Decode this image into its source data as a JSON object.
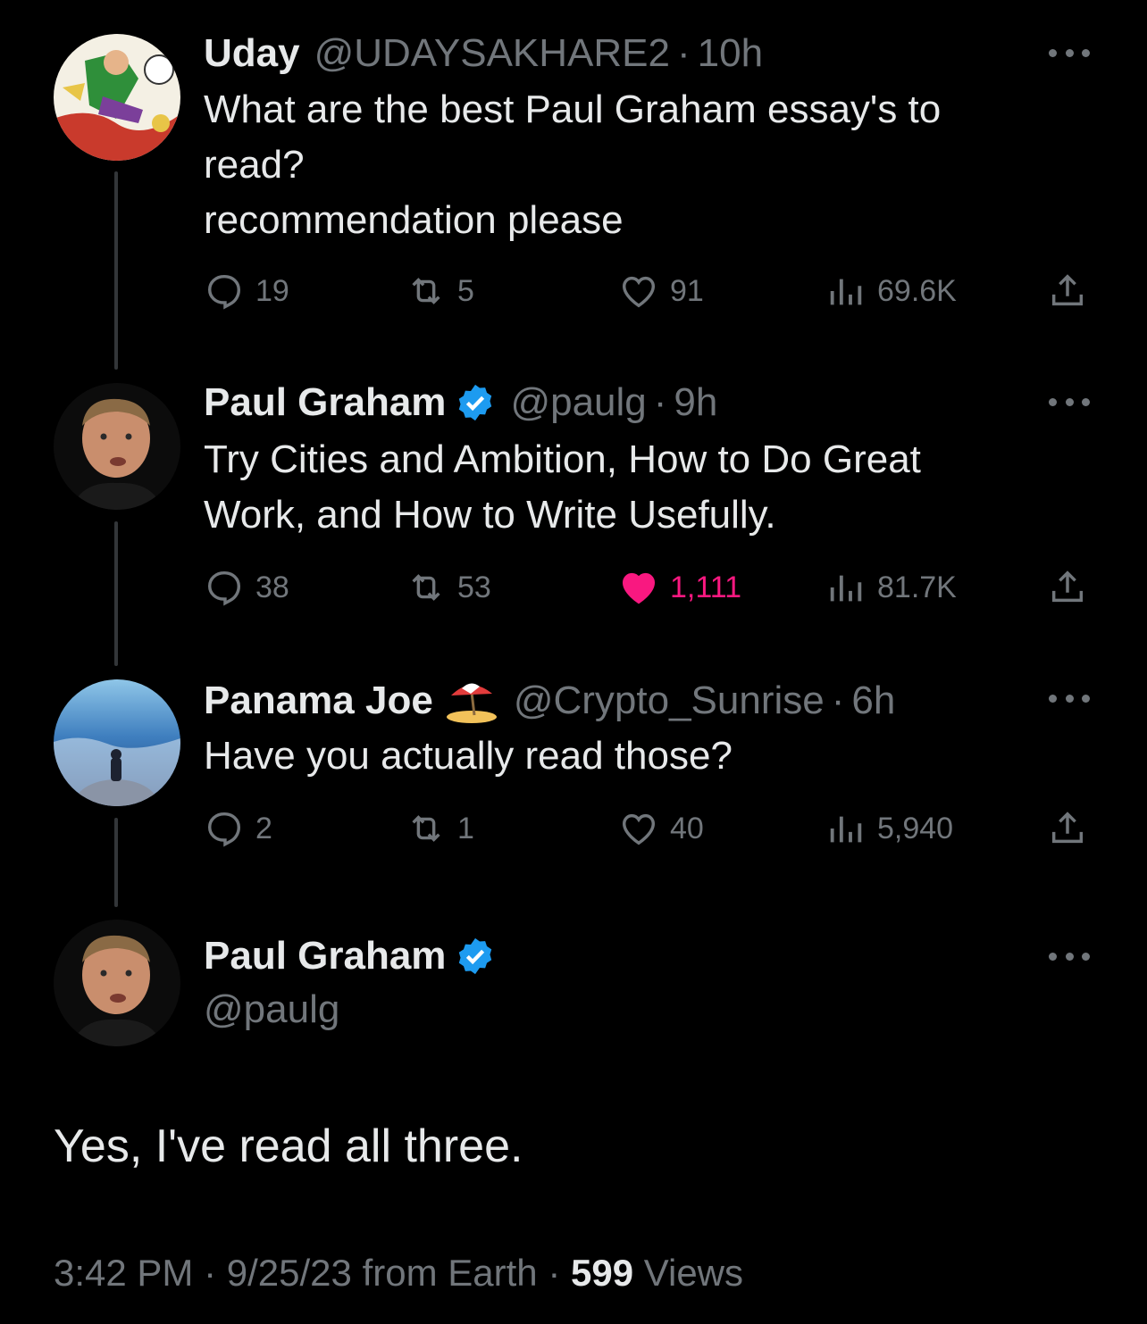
{
  "tweets": [
    {
      "name": "Uday",
      "handle": "@UDAYSAKHARE2",
      "separator": "·",
      "time": "10h",
      "verified": false,
      "emoji": "",
      "text_lines": [
        "What are the best Paul Graham essay's to",
        "read?",
        "recommendation please"
      ],
      "replies": "19",
      "retweets": "5",
      "likes": "91",
      "views": "69.6K",
      "liked": false
    },
    {
      "name": "Paul Graham",
      "handle": "@paulg",
      "separator": "·",
      "time": "9h",
      "verified": true,
      "emoji": "",
      "text_lines": [
        "Try Cities and Ambition, How to Do Great",
        "Work, and How to Write Usefully."
      ],
      "replies": "38",
      "retweets": "53",
      "likes": "1,111",
      "views": "81.7K",
      "liked": true
    },
    {
      "name": "Panama Joe",
      "handle": "@Crypto_Sunrise",
      "separator": "·",
      "time": "6h",
      "verified": false,
      "emoji": "beach-umbrella-island-emoji",
      "text_lines": [
        "Have you actually read those?"
      ],
      "replies": "2",
      "retweets": "1",
      "likes": "40",
      "views": "5,940",
      "liked": false
    }
  ],
  "main_tweet": {
    "name": "Paul Graham",
    "handle": "@paulg",
    "verified": true,
    "text": "Yes, I've read all three.",
    "time": "3:42 PM",
    "date": "9/25/23",
    "source": "from Earth",
    "separator": "·",
    "views_count": "599",
    "views_label": "Views"
  },
  "colors": {
    "background": "#000000",
    "text": "#e7e9ea",
    "secondary": "#71767b",
    "verified_blue": "#1d9bf0",
    "like_pink": "#f91880",
    "thread_line": "#333639"
  },
  "icons": [
    "reply-icon",
    "retweet-icon",
    "like-icon",
    "views-icon",
    "share-icon",
    "more-icon",
    "verified-badge-icon"
  ]
}
